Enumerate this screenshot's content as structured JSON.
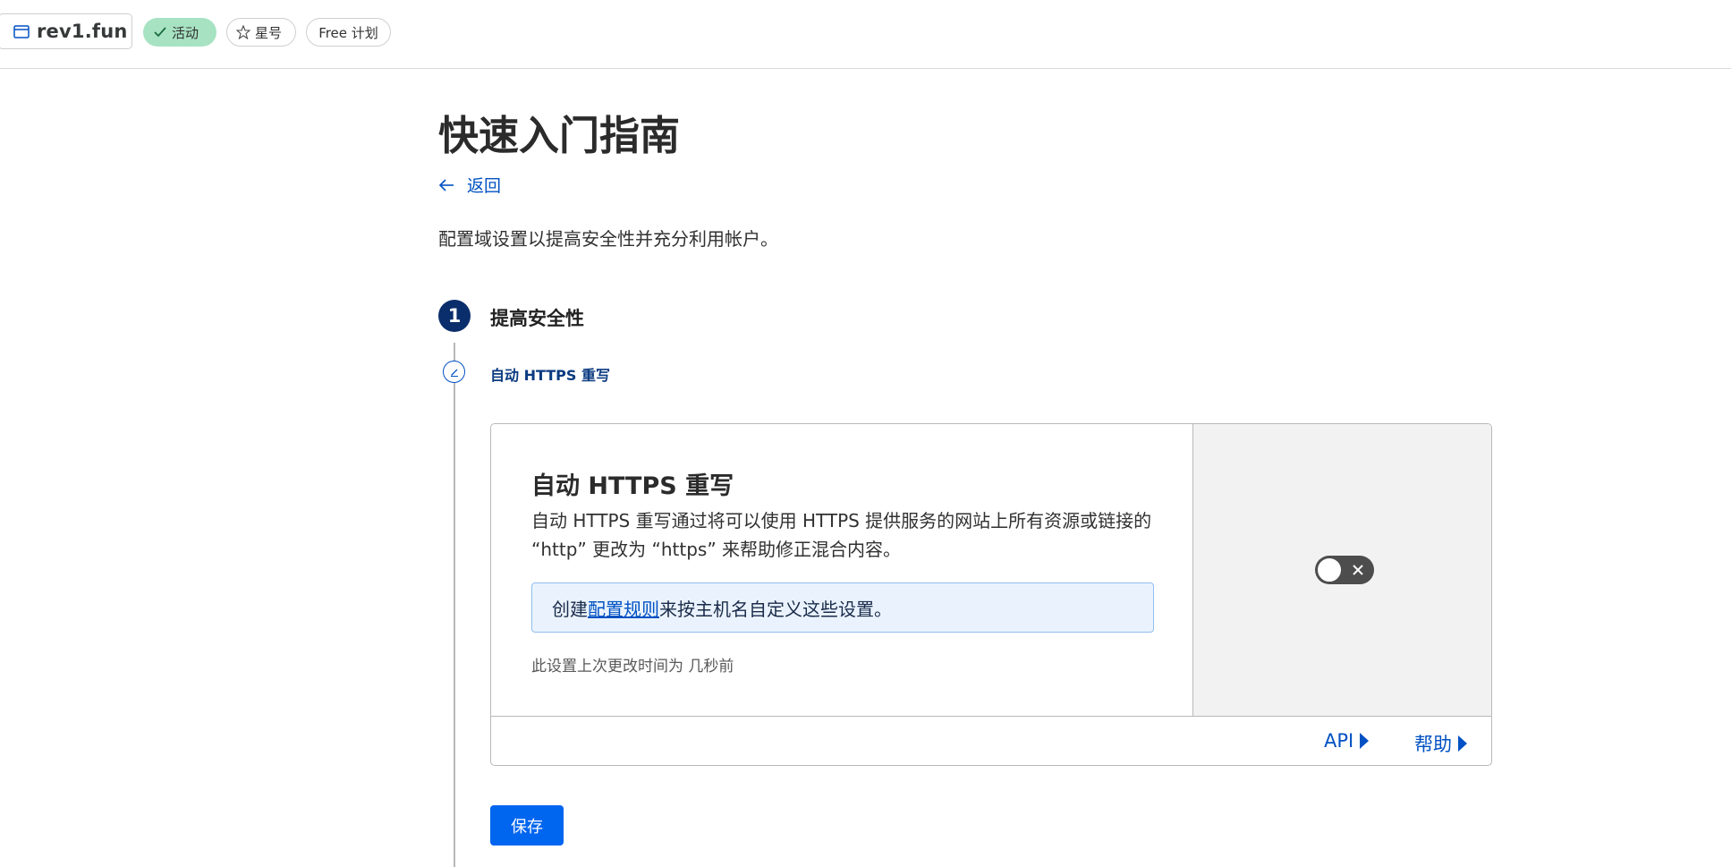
{
  "header": {
    "domain": "rev1.fun",
    "status_label": "活动",
    "star_label": "星号",
    "plan_label": "Free 计划"
  },
  "page": {
    "title": "快速入门指南",
    "back_label": "返回",
    "intro": "配置域设置以提高安全性并充分利用帐户。"
  },
  "step": {
    "number": "1",
    "title": "提高安全性",
    "substep_title": "自动 HTTPS 重写"
  },
  "card": {
    "title": "自动 HTTPS 重写",
    "description": "自动 HTTPS 重写通过将可以使用 HTTPS 提供服务的网站上所有资源或链接的 “http” 更改为 “https” 来帮助修正混合内容。",
    "info_prefix": "创建",
    "info_link": "配置规则",
    "info_suffix": "来按主机名自定义这些设置。",
    "last_changed": "此设置上次更改时间为 几秒前",
    "toggle_on": false,
    "api_label": "API",
    "help_label": "帮助"
  },
  "actions": {
    "save_label": "保存"
  },
  "colors": {
    "accent": "#0051c3",
    "primary_button": "#0065ef",
    "active_badge": "#a7e3c2",
    "step_circle": "#0a2e6b"
  }
}
